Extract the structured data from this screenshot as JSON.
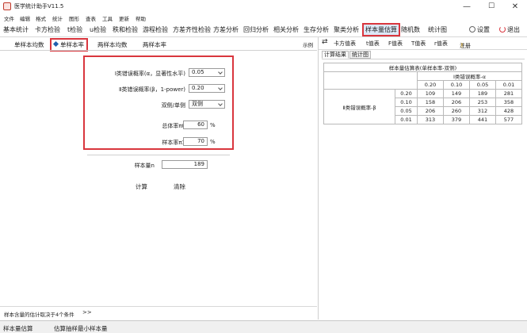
{
  "app": {
    "title": "医学统计助手V11.5",
    "window_buttons": [
      "—",
      "☐",
      "✕"
    ]
  },
  "menu": [
    "文件",
    "编辑",
    "格式",
    "统计",
    "图形",
    "查表",
    "工具",
    "更新",
    "帮助"
  ],
  "toolbar": {
    "items": [
      "基本统计",
      "卡方检验",
      "t检验",
      "u检验",
      "秩和检验",
      "游程检验",
      "方差齐性检验",
      "方差分析",
      "回归分析",
      "相关分析",
      "生存分析",
      "聚类分析",
      "样本量估算",
      "随机数",
      "统计图"
    ],
    "active": "样本量估算",
    "settings_label": "设置",
    "exit_label": "退出"
  },
  "subtabs": {
    "items": [
      "单样本均数",
      "单样本率",
      "两样本均数",
      "两样本率"
    ],
    "active": "单样本率",
    "example_label": "示例"
  },
  "form": {
    "alpha_label": "Ⅰ类错误概率(α，显著性水平)",
    "alpha_value": "0.05",
    "beta_label": "Ⅱ类错误概率(β，1-power)",
    "beta_value": "0.20",
    "sided_label": "双侧/单侧",
    "sided_value": "双侧",
    "pi0_label": "总体率π0",
    "pi0_value": "60",
    "pi1_label": "样本率π1",
    "pi1_value": "70",
    "unit": "%",
    "n_label": "样本量n",
    "n_value": "189",
    "calc_label": "计算",
    "clear_label": "清除"
  },
  "bottom_note": {
    "text": "样本含量的估计取决于4个条件",
    "chevrons": ">>"
  },
  "right_tools": [
    "卡方值表",
    "t值表",
    "F值表",
    "T值表",
    "r值表",
    "注册"
  ],
  "right_tabs": [
    "计算结果",
    "统计图"
  ],
  "results": {
    "title": "样本量估算表(单样本率-双侧)",
    "alpha_header": "Ⅰ类错误概率-α",
    "alpha_values": [
      "0.20",
      "0.10",
      "0.05",
      "0.01"
    ],
    "beta_header": "Ⅱ类错误概率-β",
    "rows": [
      {
        "beta": "0.20",
        "values": [
          "109",
          "149",
          "189",
          "281"
        ]
      },
      {
        "beta": "0.10",
        "values": [
          "158",
          "206",
          "253",
          "358"
        ]
      },
      {
        "beta": "0.05",
        "values": [
          "206",
          "260",
          "312",
          "428"
        ]
      },
      {
        "beta": "0.01",
        "values": [
          "313",
          "379",
          "441",
          "577"
        ]
      }
    ]
  },
  "status": {
    "left": "样本量估算",
    "right": "估算抽样最小样本量"
  },
  "colors": {
    "highlight_red": "#d9363e",
    "active_blue": "#1f5fae"
  }
}
